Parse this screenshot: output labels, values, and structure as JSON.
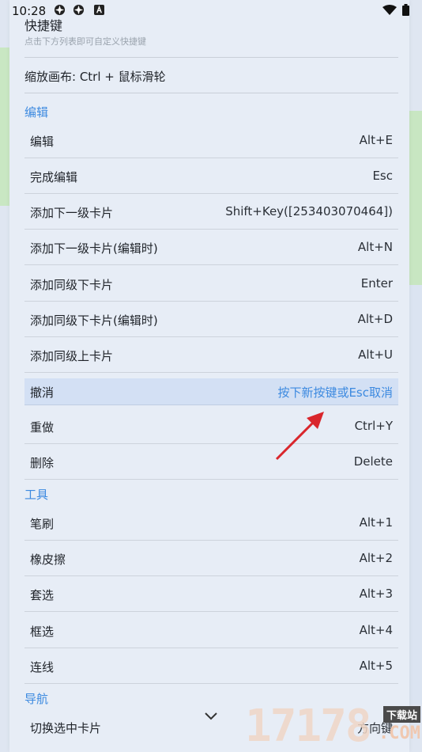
{
  "status_bar": {
    "time": "10:28"
  },
  "header": {
    "title": "快捷键",
    "subtitle": "点击下方列表即可自定义快捷键",
    "zoom_hint": "缩放画布: Ctrl + 鼠标滑轮"
  },
  "sections": {
    "edit": "编辑",
    "tools": "工具",
    "nav": "导航"
  },
  "edit_rows": [
    {
      "name": "编辑",
      "key": "Alt+E"
    },
    {
      "name": "完成编辑",
      "key": "Esc"
    },
    {
      "name": "添加下一级卡片",
      "key": "Shift+Key([253403070464])"
    },
    {
      "name": "添加下一级卡片(编辑时)",
      "key": "Alt+N"
    },
    {
      "name": "添加同级下卡片",
      "key": "Enter"
    },
    {
      "name": "添加同级下卡片(编辑时)",
      "key": "Alt+D"
    },
    {
      "name": "添加同级上卡片",
      "key": "Alt+U"
    },
    {
      "name": "撤消",
      "key": "按下新按键或Esc取消"
    },
    {
      "name": "重做",
      "key": "Ctrl+Y"
    },
    {
      "name": "删除",
      "key": "Delete"
    }
  ],
  "tool_rows": [
    {
      "name": "笔刷",
      "key": "Alt+1"
    },
    {
      "name": "橡皮擦",
      "key": "Alt+2"
    },
    {
      "name": "套选",
      "key": "Alt+3"
    },
    {
      "name": "框选",
      "key": "Alt+4"
    },
    {
      "name": "连线",
      "key": "Alt+5"
    }
  ],
  "nav_rows": [
    {
      "name": "切换选中卡片",
      "key": "方向键"
    }
  ],
  "watermark": {
    "digits": "17178",
    "tag": "下载站",
    "domain": ".COM"
  },
  "colors": {
    "accent": "#3d8ae0",
    "highlight_row": "#d3e0f4",
    "arrow": "#d9262c"
  }
}
